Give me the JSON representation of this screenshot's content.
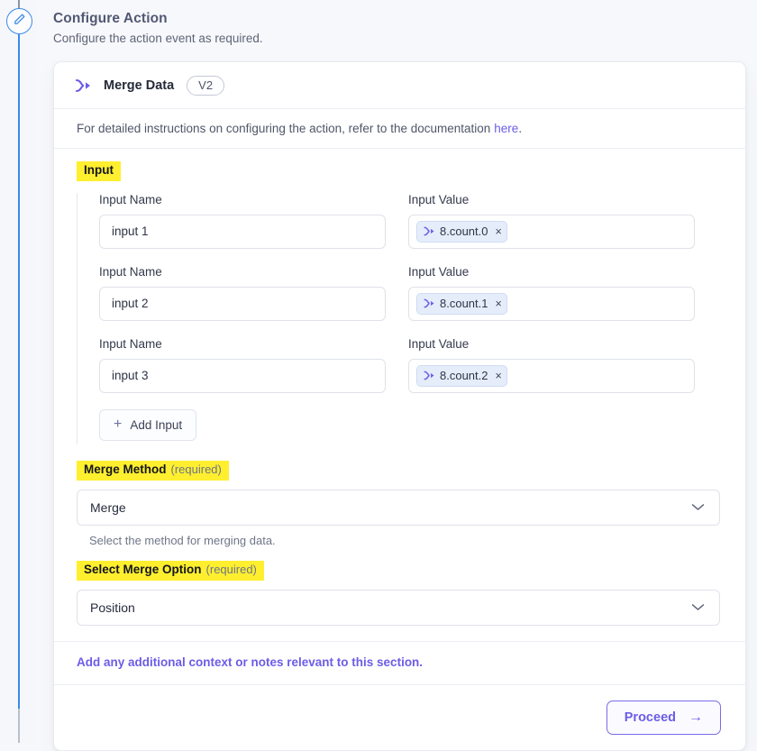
{
  "rail": {
    "badge_icon": "pencil-icon",
    "line_color_active": "#3b8ae8",
    "line_color_inactive": "#b9c0cd"
  },
  "header": {
    "title": "Configure Action",
    "subtitle": "Configure the action event as required."
  },
  "card": {
    "icon": "merge-data-icon",
    "title": "Merge Data",
    "version": "V2",
    "documentation": {
      "text": "For detailed instructions on configuring the action, refer to the documentation",
      "link_label": "here",
      "trailing": ".",
      "link_color": "#6c5ce7"
    }
  },
  "input_section": {
    "label": "Input",
    "highlight_color": "#ffef2f",
    "name_label": "Input Name",
    "value_label": "Input Value",
    "rows": [
      {
        "name_value": "input 1",
        "token": {
          "icon": "merge-data-icon",
          "text": "8.count.0",
          "remove_label": "×"
        },
        "has_delete": false
      },
      {
        "name_value": "input 2",
        "token": {
          "icon": "merge-data-icon",
          "text": "8.count.1",
          "remove_label": "×"
        },
        "has_delete": false
      },
      {
        "name_value": "input 3",
        "token": {
          "icon": "merge-data-icon",
          "text": "8.count.2",
          "remove_label": "×"
        },
        "has_delete": true,
        "delete_icon": "trash-icon"
      }
    ],
    "add_button": {
      "label": "Add Input",
      "icon": "plus-icon"
    }
  },
  "merge_method": {
    "label": "Merge Method",
    "required_flag": "(required)",
    "selected_value": "Merge",
    "chevron_icon": "chevron-down-icon",
    "hint": "Select the method for merging data."
  },
  "merge_option": {
    "label": "Select Merge Option",
    "required_flag": "(required)",
    "selected_value": "Position",
    "chevron_icon": "chevron-down-icon"
  },
  "notes": {
    "text": "Add any additional context or notes relevant to this section."
  },
  "footer": {
    "proceed_label": "Proceed",
    "proceed_arrow": "→",
    "accent_color": "#6c5ce7"
  }
}
